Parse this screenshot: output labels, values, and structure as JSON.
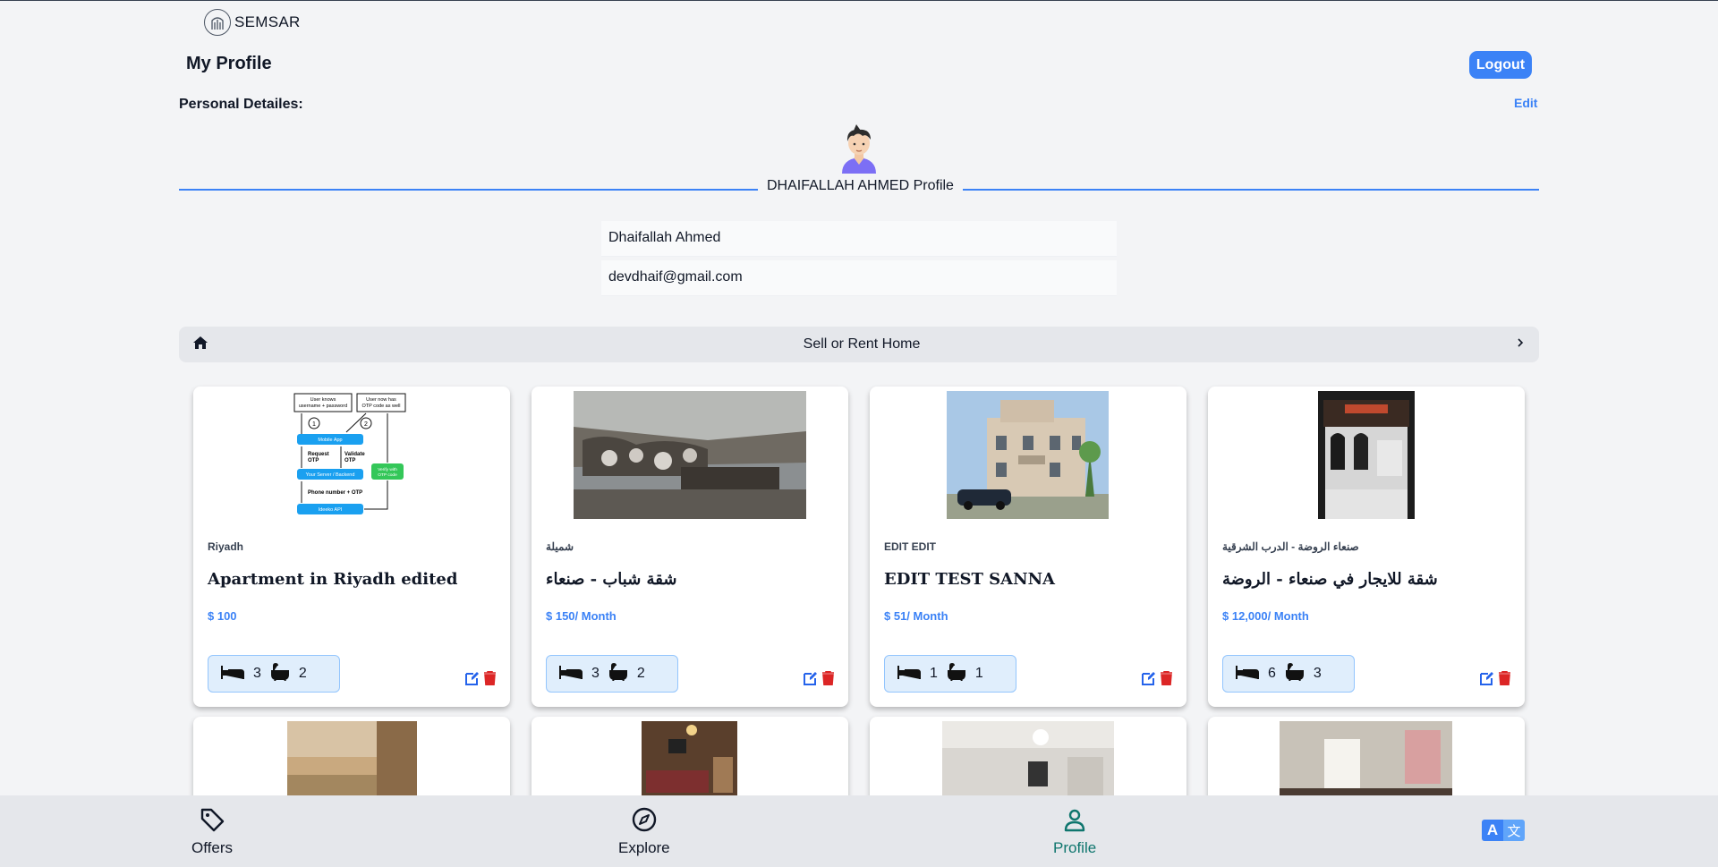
{
  "app": {
    "brand": "SEMSAR"
  },
  "header": {
    "title": "My Profile",
    "logout_label": "Logout"
  },
  "personal": {
    "section_label": "Personal Detailes:",
    "edit_label": "Edit"
  },
  "profile": {
    "heading": "DHAIFALLAH AHMED Profile",
    "name": "Dhaifallah Ahmed",
    "email": "devdhaif@gmail.com"
  },
  "sell_rent": {
    "label": "Sell or Rent Home"
  },
  "listings": [
    {
      "location": "Riyadh",
      "title": "Apartment in Riyadh edited",
      "price": "$ 100",
      "beds": "3",
      "baths": "2",
      "image": "diagram"
    },
    {
      "location": "شميلة",
      "title": "شقة شباب - صنعاء",
      "price": "$ 150/ Month",
      "beds": "3",
      "baths": "2",
      "image": "sofa"
    },
    {
      "location": "EDIT EDIT",
      "title": "EDIT TEST SANNA",
      "price": "$ 51/ Month",
      "beds": "1",
      "baths": "1",
      "image": "house"
    },
    {
      "location": "صنعاء الروضة - الدرب الشرقية",
      "title": "شقة للايجار في صنعاء - الروضة",
      "price": "$ 12,000/ Month",
      "beds": "6",
      "baths": "3",
      "image": "room"
    }
  ],
  "diagram_text": {
    "user_knows": "User knows\nusername + password",
    "user_now_has": "User now has\nOTP code as well",
    "mobile_app": "Mobile App",
    "request_otp": "Request\nOTP",
    "validate_otp": "Validate\nOTP",
    "your_server": "Your Server / Backend",
    "verify": "Verify with\nOTP code",
    "phone_otp": "Phone number + OTP",
    "api": "Ideeko API"
  },
  "nav": {
    "offers": "Offers",
    "explore": "Explore",
    "profile": "Profile"
  },
  "colors": {
    "accent": "#3b82f6",
    "active_nav": "#0f766e",
    "delete": "#dc2626"
  }
}
